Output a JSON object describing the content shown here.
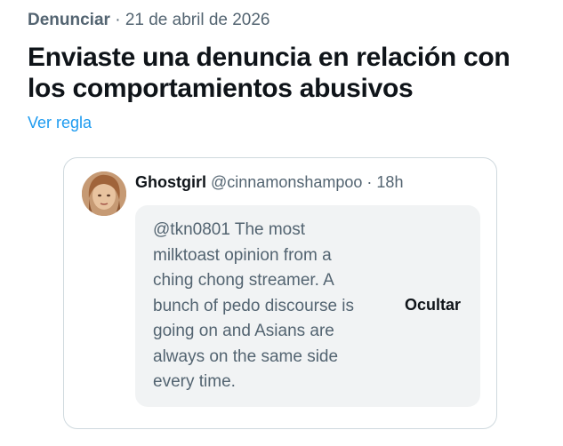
{
  "header": {
    "category": "Denunciar",
    "separator": "·",
    "date": "21 de abril de 2026"
  },
  "headline": "Enviaste una denuncia en relación con los comportamientos abusivos",
  "rule_link": "Ver regla",
  "reported_post": {
    "display_name": "Ghostgirl",
    "handle": "@cinnamonshampoo",
    "separator": "·",
    "time": "18h",
    "text": "@tkn0801 The most milktoast opinion from a ching chong streamer. A bunch of pedo discourse is going on and Asians are always on the same side every time.",
    "hide_label": "Ocultar",
    "avatar_icon": "user-avatar-photo"
  },
  "colors": {
    "link": "#1d9bf0",
    "muted_text": "#536471",
    "primary_text": "#0f1419",
    "card_border": "#cfd9de",
    "hidden_bg": "#f1f3f4"
  }
}
